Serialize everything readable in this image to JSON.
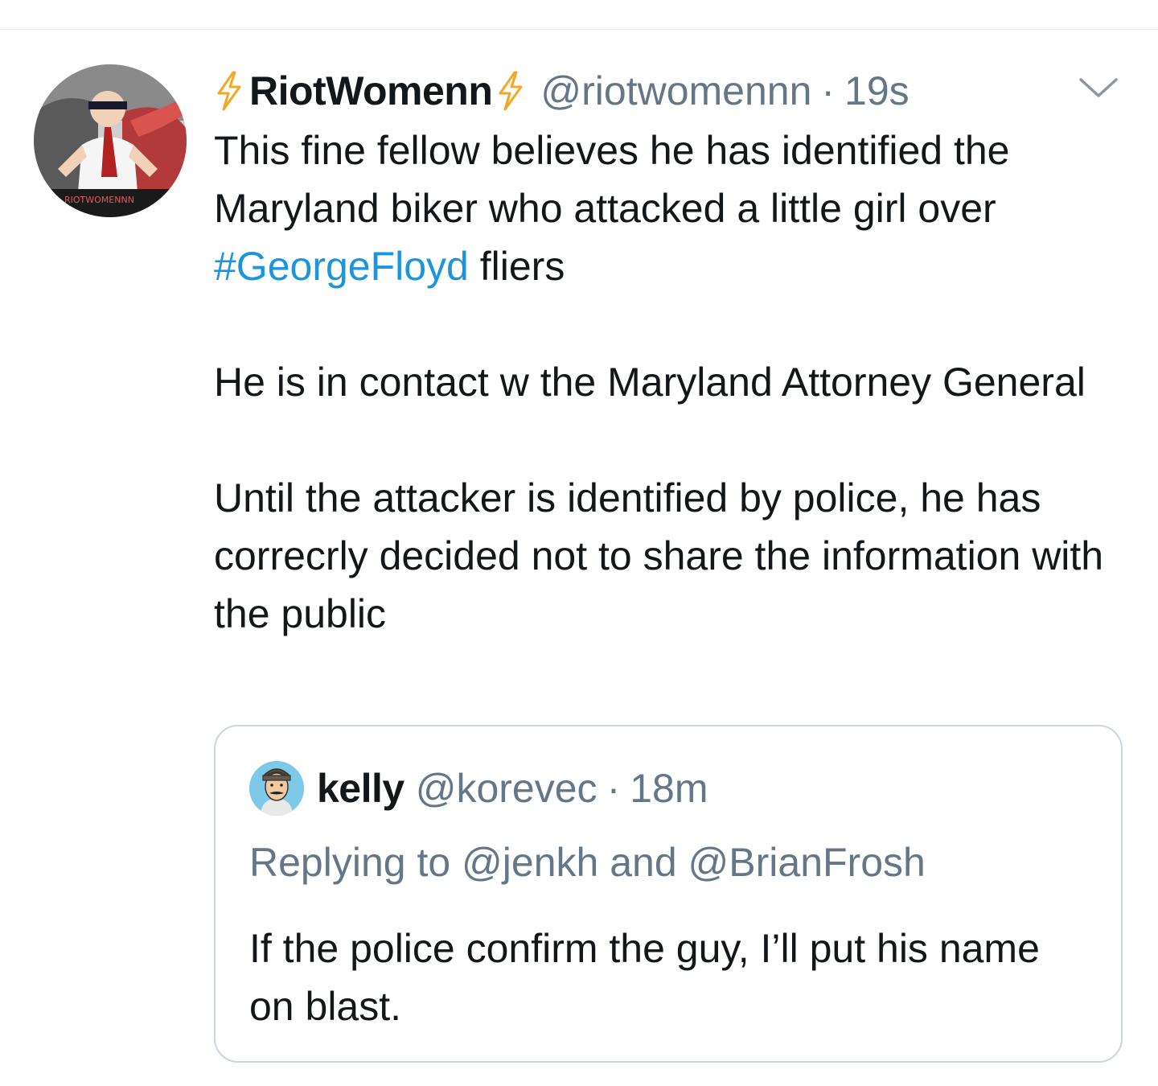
{
  "tweet": {
    "display_name": "RiotWomenn",
    "handle": "@riotwomennn",
    "separator": "·",
    "time": "19s",
    "avatar_watermark": "RIOTWOMENNN",
    "body_line1_text": "This fine fellow believes he has identified the Maryland biker who attacked a little girl over ",
    "hashtag": "#GeorgeFloyd",
    "body_line1_tail": " fliers",
    "body_para2": "He is in contact w the Maryland Attorney General",
    "body_para3": "Until the attacker is identified by police, he has correcrly decided not to share the information with the public"
  },
  "quoted_tweet": {
    "display_name": "kelly",
    "handle": "@korevec",
    "separator": "·",
    "time": "18m",
    "replying_to": "Replying to @jenkh and @BrianFrosh",
    "body": "If the police confirm the guy, I’ll put his name on blast."
  },
  "icons": {
    "bolt_left": "lightning-bolt-icon",
    "bolt_right": "lightning-bolt-icon",
    "caret": "chevron-down-icon"
  },
  "colors": {
    "link": "#1b95e0",
    "secondary_text": "#657786",
    "primary_text": "#14171a",
    "border": "#ccd6dd",
    "bolt": "#f5a623"
  }
}
